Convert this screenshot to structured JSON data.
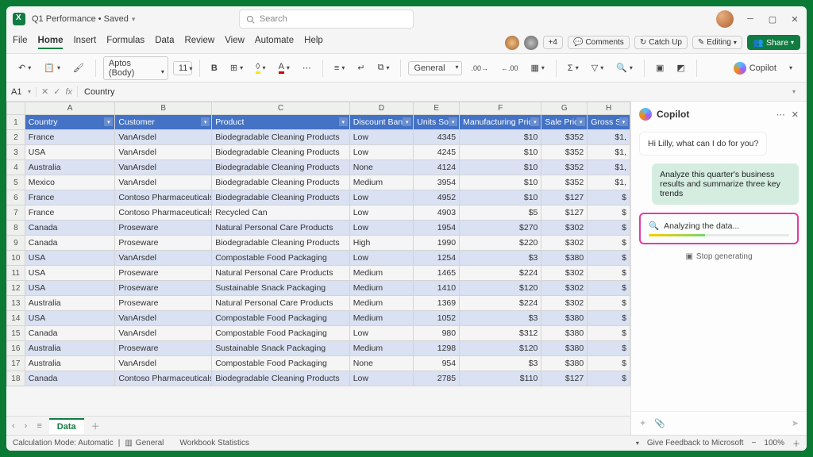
{
  "titlebar": {
    "title": "Q1 Performance • Saved",
    "search_placeholder": "Search"
  },
  "menus": {
    "file": "File",
    "home": "Home",
    "insert": "Insert",
    "formulas": "Formulas",
    "data": "Data",
    "review": "Review",
    "view": "View",
    "automate": "Automate",
    "help": "Help"
  },
  "menubar_right": {
    "badge": "+4",
    "comments": "Comments",
    "catchup": "Catch Up",
    "editing": "Editing",
    "share": "Share"
  },
  "ribbon": {
    "font": "Aptos (Body)",
    "size": "11",
    "numfmt": "General",
    "copilot": "Copilot"
  },
  "namebox": {
    "ref": "A1",
    "formula": "Country"
  },
  "columns": [
    "A",
    "B",
    "C",
    "D",
    "E",
    "F",
    "G",
    "H"
  ],
  "headers": [
    "Country",
    "Customer",
    "Product",
    "Discount Band",
    "Units Sold",
    "Manufacturing Price",
    "Sale Price",
    "Gross Sal"
  ],
  "rows": [
    [
      "France",
      "VanArsdel",
      "Biodegradable Cleaning Products",
      "Low",
      "4345",
      "$10",
      "$352",
      "$1,"
    ],
    [
      "USA",
      "VanArsdel",
      "Biodegradable Cleaning Products",
      "Low",
      "4245",
      "$10",
      "$352",
      "$1,"
    ],
    [
      "Australia",
      "VanArsdel",
      "Biodegradable Cleaning Products",
      "None",
      "4124",
      "$10",
      "$352",
      "$1,"
    ],
    [
      "Mexico",
      "VanArsdel",
      "Biodegradable Cleaning Products",
      "Medium",
      "3954",
      "$10",
      "$352",
      "$1,"
    ],
    [
      "France",
      "Contoso Pharmaceuticals",
      "Biodegradable Cleaning Products",
      "Low",
      "4952",
      "$10",
      "$127",
      "$"
    ],
    [
      "France",
      "Contoso Pharmaceuticals",
      "Recycled Can",
      "Low",
      "4903",
      "$5",
      "$127",
      "$"
    ],
    [
      "Canada",
      "Proseware",
      "Natural Personal Care Products",
      "Low",
      "1954",
      "$270",
      "$302",
      "$"
    ],
    [
      "Canada",
      "Proseware",
      "Biodegradable Cleaning Products",
      "High",
      "1990",
      "$220",
      "$302",
      "$"
    ],
    [
      "USA",
      "VanArsdel",
      "Compostable Food Packaging",
      "Low",
      "1254",
      "$3",
      "$380",
      "$"
    ],
    [
      "USA",
      "Proseware",
      "Natural Personal Care Products",
      "Medium",
      "1465",
      "$224",
      "$302",
      "$"
    ],
    [
      "USA",
      "Proseware",
      "Sustainable Snack Packaging",
      "Medium",
      "1410",
      "$120",
      "$302",
      "$"
    ],
    [
      "Australia",
      "Proseware",
      "Natural Personal Care Products",
      "Medium",
      "1369",
      "$224",
      "$302",
      "$"
    ],
    [
      "USA",
      "VanArsdel",
      "Compostable Food Packaging",
      "Medium",
      "1052",
      "$3",
      "$380",
      "$"
    ],
    [
      "Canada",
      "VanArsdel",
      "Compostable Food Packaging",
      "Low",
      "980",
      "$312",
      "$380",
      "$"
    ],
    [
      "Australia",
      "Proseware",
      "Sustainable Snack Packaging",
      "Medium",
      "1298",
      "$120",
      "$380",
      "$"
    ],
    [
      "Australia",
      "VanArsdel",
      "Compostable Food Packaging",
      "None",
      "954",
      "$3",
      "$380",
      "$"
    ],
    [
      "Canada",
      "Contoso Pharmaceuticals",
      "Biodegradable Cleaning Products",
      "Low",
      "2785",
      "$110",
      "$127",
      "$"
    ]
  ],
  "sheet_tab": "Data",
  "statusbar": {
    "calc": "Calculation Mode: Automatic",
    "general": "General",
    "wbstats": "Workbook Statistics",
    "feedback": "Give Feedback to Microsoft",
    "zoom": "100%"
  },
  "copilot": {
    "title": "Copilot",
    "greeting": "Hi Lilly, what can I do for you?",
    "user_msg": "Analyze this quarter's business results and summarize three key trends",
    "analyzing": "Analyzing the data...",
    "stop": "Stop generating"
  }
}
